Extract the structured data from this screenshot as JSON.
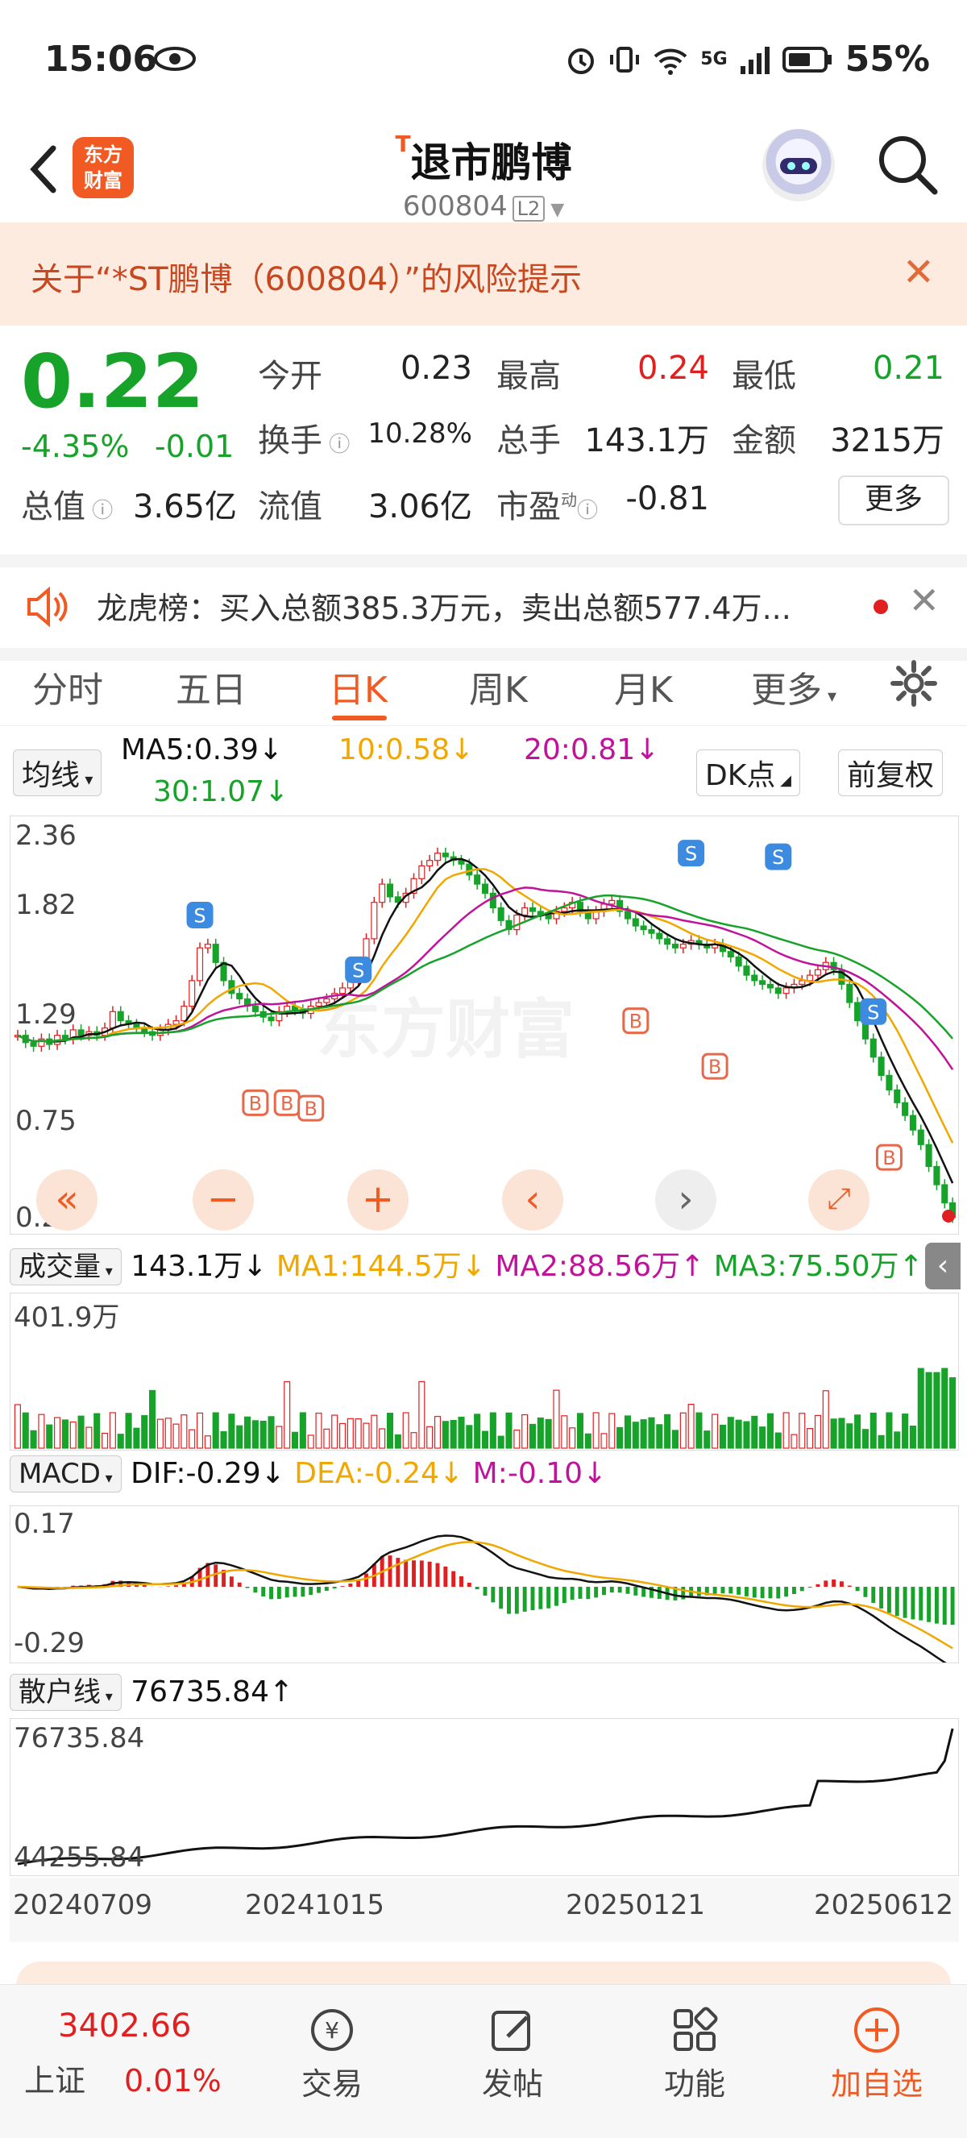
{
  "status_bar": {
    "time": "15:06",
    "battery": "55%",
    "network": "5G"
  },
  "header": {
    "logo_text": [
      "东方",
      "财富"
    ],
    "title_prefix": "T",
    "title": "退市鹏博",
    "code": "600804",
    "level": "L2"
  },
  "banner": {
    "text": "关于“*ST鹏博（600804）”的风险提示"
  },
  "quote": {
    "price": "0.22",
    "change_pct": "-4.35%",
    "change": "-0.01",
    "open_label": "今开",
    "open": "0.23",
    "high_label": "最高",
    "high": "0.24",
    "low_label": "最低",
    "low": "0.21",
    "turnover_label": "换手",
    "turnover": "10.28%",
    "volume_label": "总手",
    "volume": "143.1万",
    "amount_label": "金额",
    "amount": "3215万",
    "mktcap_label": "总值",
    "mktcap": "3.65亿",
    "float_label": "流值",
    "float": "3.06亿",
    "pe_label": "市盈",
    "pe_sup": "动",
    "pe": "-0.81",
    "more": "更多"
  },
  "lhb": {
    "text": "龙虎榜：买入总额385.3万元，卖出总额577.4万..."
  },
  "tabs": [
    "分时",
    "五日",
    "日K",
    "周K",
    "月K",
    "更多"
  ],
  "active_tab": "日K",
  "ma": {
    "selector": "均线",
    "ma5": "MA5:0.39",
    "ma10": "10:0.58",
    "ma20": "20:0.81",
    "ma30": "30:1.07",
    "dk": "DK点",
    "adjust": "前复权"
  },
  "kline": {
    "y_labels": [
      "2.36",
      "1.82",
      "1.29",
      "0.75",
      "0.21"
    ],
    "watermark": "东方财富"
  },
  "volume": {
    "selector": "成交量",
    "value": "143.1万",
    "ma1": "MA1:144.5万",
    "ma2": "MA2:88.56万",
    "ma3": "MA3:75.50万",
    "top": "401.9万"
  },
  "macd": {
    "selector": "MACD",
    "dif": "DIF:-0.29",
    "dea": "DEA:-0.24",
    "m": "M:-0.10",
    "top": "0.17",
    "bottom": "-0.29"
  },
  "retail": {
    "selector": "散户线",
    "value": "76735.84",
    "top": "76735.84",
    "bottom": "44255.84"
  },
  "dates": [
    "20240709",
    "20241015",
    "20250121",
    "20250612"
  ],
  "bottom_nav": {
    "index_value": "3402.66",
    "index_name": "上证",
    "index_change": "0.01%",
    "items": [
      "交易",
      "发帖",
      "功能",
      "加自选"
    ]
  },
  "colors": {
    "up": "#e02020",
    "down": "#17a32a",
    "accent": "#f15a22",
    "ma5": "#111111",
    "ma10": "#f0a800",
    "ma20": "#c0139b",
    "ma30": "#17a32a"
  },
  "chart_data": {
    "type": "candlestick",
    "ylim": [
      0.21,
      2.36
    ],
    "close": [
      1.22,
      1.18,
      1.16,
      1.2,
      1.17,
      1.22,
      1.2,
      1.25,
      1.22,
      1.24,
      1.22,
      1.26,
      1.35,
      1.3,
      1.28,
      1.26,
      1.24,
      1.22,
      1.25,
      1.28,
      1.3,
      1.38,
      1.52,
      1.7,
      1.72,
      1.62,
      1.52,
      1.45,
      1.42,
      1.38,
      1.35,
      1.32,
      1.3,
      1.35,
      1.38,
      1.36,
      1.34,
      1.38,
      1.4,
      1.42,
      1.45,
      1.48,
      1.52,
      1.58,
      1.75,
      1.95,
      2.05,
      1.98,
      1.95,
      2.0,
      2.08,
      2.15,
      2.18,
      2.22,
      2.2,
      2.18,
      2.16,
      2.1,
      2.05,
      2.0,
      1.92,
      1.85,
      1.8,
      1.88,
      1.92,
      1.9,
      1.88,
      1.86,
      1.9,
      1.92,
      1.95,
      1.9,
      1.86,
      1.9,
      1.94,
      1.96,
      1.9,
      1.86,
      1.82,
      1.8,
      1.78,
      1.75,
      1.72,
      1.7,
      1.72,
      1.74,
      1.72,
      1.7,
      1.72,
      1.68,
      1.65,
      1.6,
      1.55,
      1.52,
      1.5,
      1.48,
      1.45,
      1.48,
      1.5,
      1.52,
      1.55,
      1.58,
      1.62,
      1.58,
      1.5,
      1.4,
      1.3,
      1.2,
      1.1,
      1.0,
      0.92,
      0.85,
      0.78,
      0.7,
      0.62,
      0.5,
      0.4,
      0.3,
      0.22
    ]
  }
}
